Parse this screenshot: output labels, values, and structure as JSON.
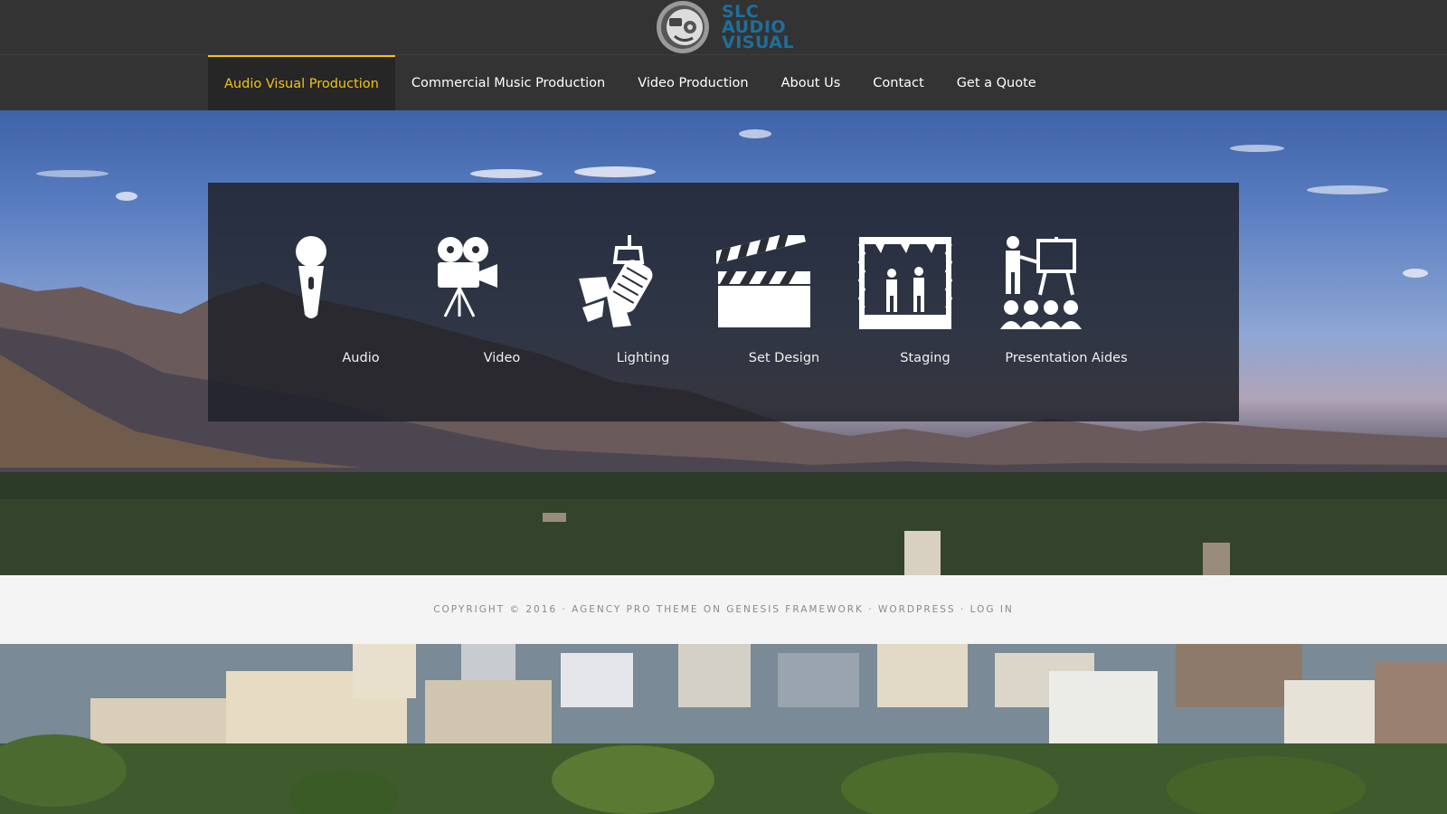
{
  "brand": {
    "logo_text": [
      "SLC",
      "AUDIO",
      "VISUAL"
    ],
    "accent_color": "#f2c21b",
    "logo_color": "#1f6f9a"
  },
  "nav": {
    "items": [
      {
        "label": "Audio Visual Production",
        "active": true
      },
      {
        "label": "Commercial Music Production",
        "active": false
      },
      {
        "label": "Video Production",
        "active": false
      },
      {
        "label": "About Us",
        "active": false
      },
      {
        "label": "Contact",
        "active": false
      },
      {
        "label": "Get a Quote",
        "active": false
      }
    ]
  },
  "services": [
    {
      "label": "Audio",
      "icon": "microphone-icon"
    },
    {
      "label": "Video",
      "icon": "film-camera-icon"
    },
    {
      "label": "Lighting",
      "icon": "spotlight-icon"
    },
    {
      "label": "Set Design",
      "icon": "clapperboard-icon"
    },
    {
      "label": "Staging",
      "icon": "stage-icon"
    },
    {
      "label": "Presentation Aides",
      "icon": "presenter-easel-icon"
    }
  ],
  "footer": {
    "copyright": "COPYRIGHT © 2016 ·",
    "theme_link": "AGENCY PRO THEME",
    "on": "ON",
    "framework_link": "GENESIS FRAMEWORK",
    "sep": "·",
    "wordpress_link": "WORDPRESS",
    "login_link": "LOG IN"
  }
}
